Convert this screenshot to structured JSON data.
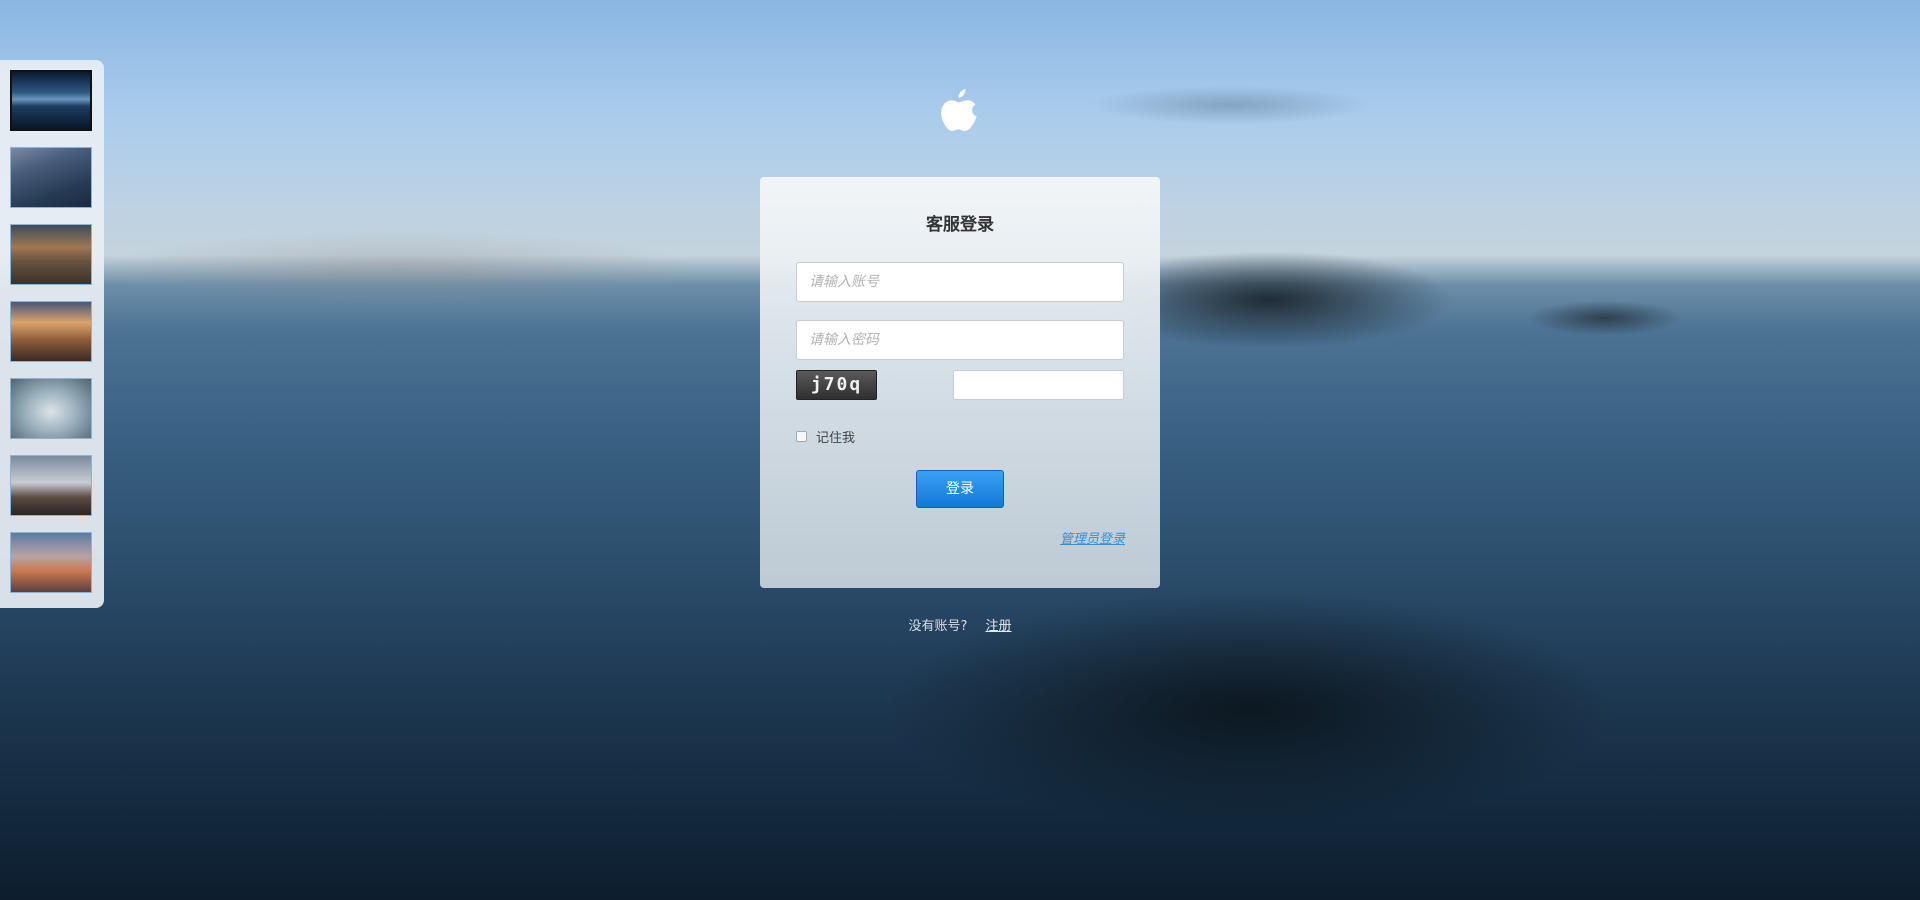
{
  "logo": {
    "icon": "apple-icon"
  },
  "thumbnails": [
    {
      "name": "thumbnail-lake-island",
      "active": true
    },
    {
      "name": "thumbnail-night-sky"
    },
    {
      "name": "thumbnail-sunset-mountain"
    },
    {
      "name": "thumbnail-desert-sunset"
    },
    {
      "name": "thumbnail-cloud-wave"
    },
    {
      "name": "thumbnail-waterfall"
    },
    {
      "name": "thumbnail-evening-sky"
    }
  ],
  "login": {
    "title": "客服登录",
    "account_placeholder": "请输入账号",
    "password_placeholder": "请输入密码",
    "captcha_text": "j70q",
    "captcha_value": "",
    "remember_label": "记住我",
    "submit_label": "登录",
    "admin_link": "管理员登录"
  },
  "footer": {
    "no_account_text": "没有账号?",
    "register_link": "注册"
  },
  "colors": {
    "button_blue": "#1a82e2",
    "link_blue": "#3a8ed6"
  }
}
